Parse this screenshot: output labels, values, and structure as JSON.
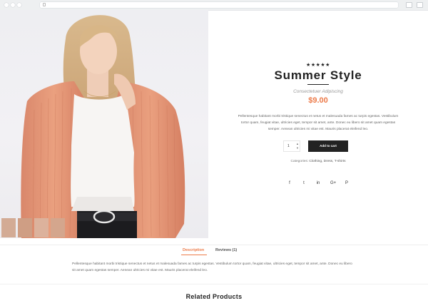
{
  "browser": {
    "url": ""
  },
  "product": {
    "rating_stars": "★★★★★",
    "title": "Summer Style",
    "subtitle": "Consectetuer Adipiscing",
    "price": "$9.00",
    "description": "Pellentesque habitant morbi tristique senectus et netus et malesuada fames ac turpis egestas. Vestibulum tortor quam, feugiat vitae, ultricies eget, tempor sit amet, ante. Donec eu libero sit amet quam egestas semper. Aenean ultricies mi vitae est. Mauris placerat eleifend leo.",
    "quantity": "1",
    "quantity_up": "▲",
    "quantity_down": "▼",
    "add_to_cart_label": "Add to cart",
    "categories_label": "Categories:",
    "categories_value": "Clothing, Dress, T-shirts",
    "social_icons": [
      "facebook-icon",
      "twitter-icon",
      "linkedin-icon",
      "google-plus-icon",
      "pinterest-icon"
    ],
    "social_glyphs": [
      "f",
      "t",
      "in",
      "G+",
      "P"
    ]
  },
  "tabs": [
    {
      "label": "Description",
      "active": true
    },
    {
      "label": "Reviews (1)",
      "active": false
    }
  ],
  "tab_content": "Pellentesque habitant morbi tristique senectus et netus et malesuada fames ac turpis egestas. Vestibulum tortor quam, feugiat vitae, ultricies eget, tempor sit amet, ante. Donec eu libero sit amet quam egestas semper. Aenean ultricies mi vitae est. Mauris placerat eleifend leo.",
  "related_title": "Related Products",
  "colors": {
    "accent": "#ec7b4a",
    "button": "#222222"
  }
}
